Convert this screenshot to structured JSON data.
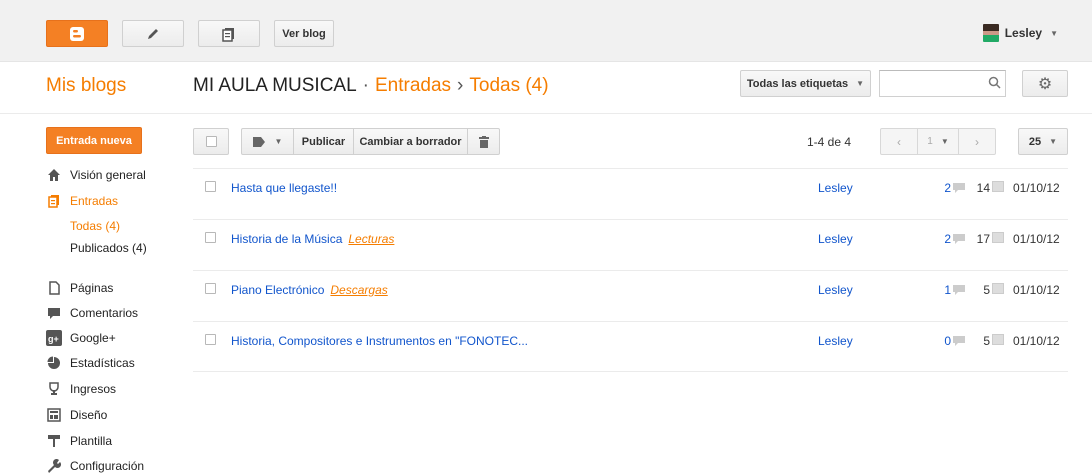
{
  "topbar": {
    "view_blog": "Ver blog",
    "user_name": "Lesley"
  },
  "header": {
    "my_blogs": "Mis blogs",
    "blog_title": "MI AULA MUSICAL",
    "crumb_sep": "·",
    "section": "Entradas",
    "arrow": "›",
    "current": "Todas (4)",
    "labels_filter": "Todas las etiquetas"
  },
  "sidebar": {
    "new_post": "Entrada nueva",
    "items": [
      {
        "label": "Visión general",
        "icon": "home-icon"
      },
      {
        "label": "Entradas",
        "icon": "posts-icon"
      },
      {
        "label": "Páginas",
        "icon": "page-icon"
      },
      {
        "label": "Comentarios",
        "icon": "comment-icon"
      },
      {
        "label": "Google+",
        "icon": "googleplus-icon"
      },
      {
        "label": "Estadísticas",
        "icon": "pie-icon"
      },
      {
        "label": "Ingresos",
        "icon": "trophy-icon"
      },
      {
        "label": "Diseño",
        "icon": "layout-icon"
      },
      {
        "label": "Plantilla",
        "icon": "paint-roller-icon"
      },
      {
        "label": "Configuración",
        "icon": "wrench-icon"
      }
    ],
    "sub_items": [
      {
        "label": "Todas (4)"
      },
      {
        "label": "Publicados (4)"
      }
    ]
  },
  "toolbar": {
    "publish": "Publicar",
    "revert_draft": "Cambiar a borrador",
    "page_count": "1-4 de 4",
    "page_num": "1",
    "per_page": "25"
  },
  "posts": [
    {
      "title": "Hasta que llegaste!!",
      "label": "",
      "author": "Lesley",
      "comments": "2",
      "views": "14",
      "date": "01/10/12"
    },
    {
      "title": "Historia de la Música",
      "label": "Lecturas",
      "author": "Lesley",
      "comments": "2",
      "views": "17",
      "date": "01/10/12"
    },
    {
      "title": "Piano Electrónico",
      "label": "Descargas",
      "author": "Lesley",
      "comments": "1",
      "views": "5",
      "date": "01/10/12"
    },
    {
      "title": "Historia, Compositores e Instrumentos en \"FONOTEC...",
      "label": "",
      "author": "Lesley",
      "comments": "0",
      "views": "5",
      "date": "01/10/12"
    }
  ],
  "colors": {
    "accent": "#f57d00",
    "link": "#1155cc"
  }
}
